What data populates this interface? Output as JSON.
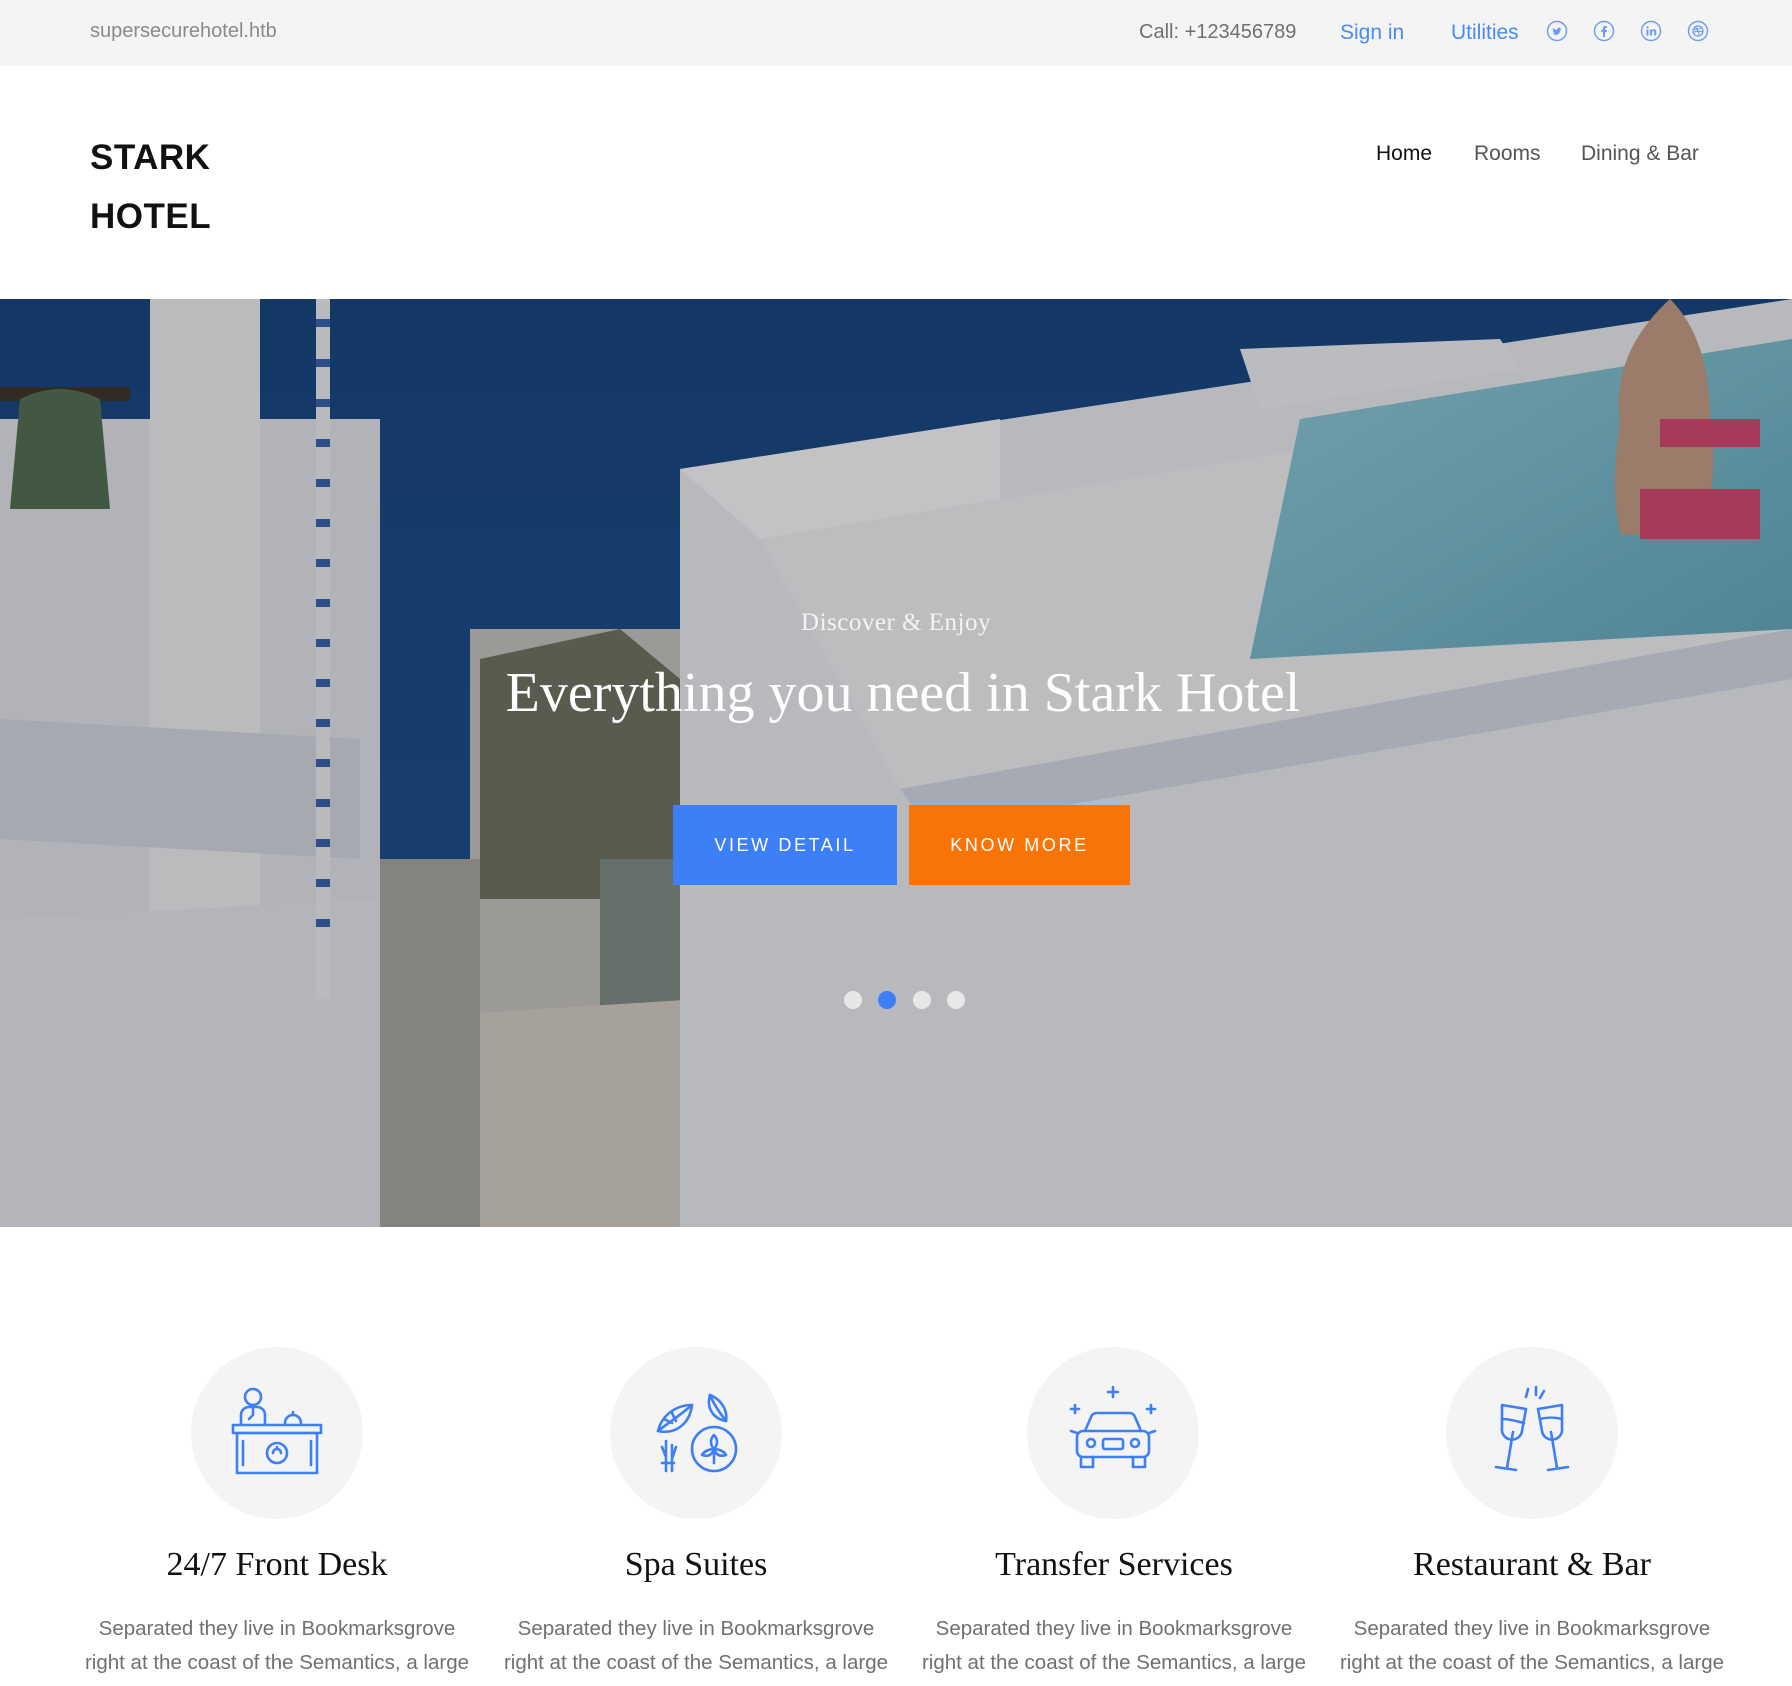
{
  "topbar": {
    "domain": "supersecurehotel.htb",
    "phone": "Call: +123456789",
    "sign_in": "Sign in",
    "utilities": "Utilities",
    "social_icons": [
      "twitter-icon",
      "facebook-icon",
      "linkedin-icon",
      "dribbble-icon"
    ],
    "link_color": "#4a8af4"
  },
  "header": {
    "brand_line1": "STARK",
    "brand_line2": "HOTEL",
    "nav": [
      "Home",
      "Rooms",
      "Dining & Bar"
    ],
    "active_nav": "Home"
  },
  "hero": {
    "eyebrow": "Discover & Enjoy",
    "headline": "Everything you need in Stark Hotel",
    "buttons": {
      "view_detail": "VIEW DETAIL",
      "know_more": "KNOW MORE"
    },
    "slide_count": 4,
    "active_slide": 2,
    "colors": {
      "primary": "#3d7ff6",
      "accent": "#f97406"
    }
  },
  "features": [
    {
      "icon": "front-desk-icon",
      "title": "24/7 Front Desk",
      "desc_line1": "Separated they live in Bookmarksgrove",
      "desc_line2": "right at the coast of the Semantics, a large"
    },
    {
      "icon": "spa-icon",
      "title": "Spa Suites",
      "desc_line1": "Separated they live in Bookmarksgrove",
      "desc_line2": "right at the coast of the Semantics, a large"
    },
    {
      "icon": "car-icon",
      "title": "Transfer Services",
      "desc_line1": "Separated they live in Bookmarksgrove",
      "desc_line2": "right at the coast of the Semantics, a large"
    },
    {
      "icon": "toast-glasses-icon",
      "title": "Restaurant & Bar",
      "desc_line1": "Separated they live in Bookmarksgrove",
      "desc_line2": "right at the coast of the Semantics, a large"
    }
  ]
}
